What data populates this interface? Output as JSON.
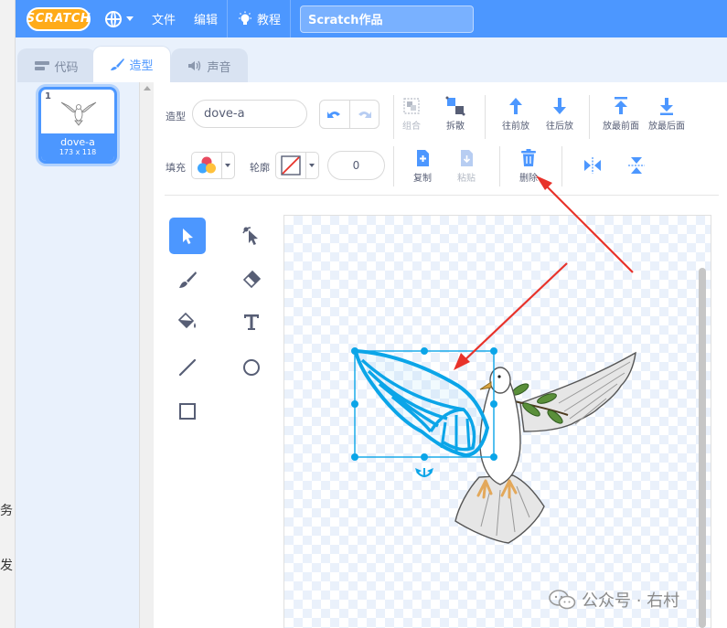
{
  "left_strip": {
    "glyphs": [
      "务",
      "发"
    ]
  },
  "menubar": {
    "logo": "SCRATCH",
    "file": "文件",
    "edit": "编辑",
    "tutorials": "教程",
    "project_title": "Scratch作品"
  },
  "tabs": [
    {
      "label": "代码",
      "icon": "code-icon",
      "active": false
    },
    {
      "label": "造型",
      "icon": "brush-icon",
      "active": true
    },
    {
      "label": "声音",
      "icon": "speaker-icon",
      "active": false
    }
  ],
  "costume": {
    "number": "1",
    "name": "dove-a",
    "size": "173 x 118"
  },
  "editor": {
    "costume_label": "造型",
    "costume_name": "dove-a",
    "fill_label": "填充",
    "outline_label": "轮廓",
    "outline_width": "0",
    "group": "组合",
    "ungroup": "拆散",
    "forward": "往前放",
    "backward": "往后放",
    "front": "放最前面",
    "back": "放最后面",
    "copy": "复制",
    "paste": "粘贴",
    "delete": "删除"
  },
  "colors": {
    "accent": "#4c97ff",
    "selection": "#0ba5e8",
    "annotation": "#e8322a"
  },
  "watermark": {
    "text": "公众号 · 右村"
  }
}
